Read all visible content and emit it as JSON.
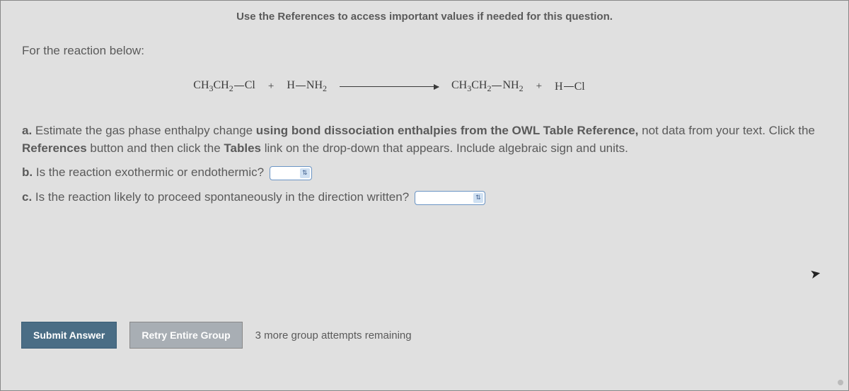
{
  "hint": "Use the References to access important values if needed for this question.",
  "intro": "For the reaction below:",
  "reaction": {
    "r1_a": "CH",
    "r1_b": "CH",
    "r1_c": "Cl",
    "r2_a": "H",
    "r2_b": "NH",
    "p1_a": "CH",
    "p1_b": "CH",
    "p1_c": "NH",
    "p2_a": "H",
    "p2_b": "Cl",
    "plus": "+"
  },
  "parts": {
    "a": {
      "label": "a. ",
      "t1": "Estimate the gas phase enthalpy change ",
      "b1": "using bond dissociation enthalpies from the OWL Table Reference,",
      "t2": " not data from your text. Click the ",
      "b2": "References",
      "t3": " button and then click the ",
      "b3": "Tables",
      "t4": " link on the drop-down that appears. Include algebraic sign and units."
    },
    "b": {
      "label": "b. ",
      "text": "Is the reaction exothermic or endothermic?"
    },
    "c": {
      "label": "c. ",
      "text": "Is the reaction likely to proceed spontaneously in the direction written?"
    }
  },
  "footer": {
    "submit": "Submit Answer",
    "retry": "Retry Entire Group",
    "attempts": "3 more group attempts remaining"
  }
}
